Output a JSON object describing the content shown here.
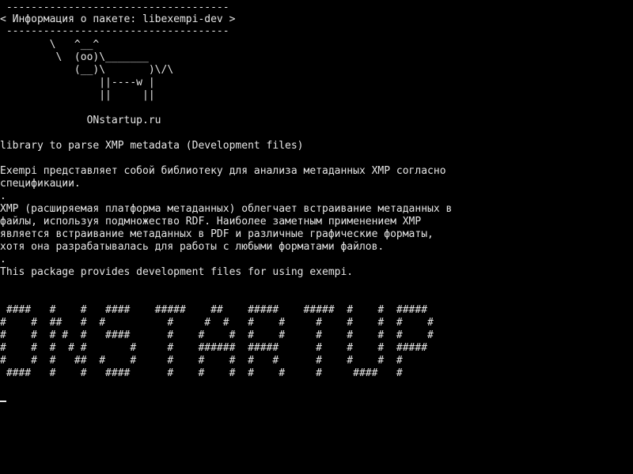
{
  "terminal": {
    "speech_top": " ------------------------------------",
    "speech_text": "< Информация о пакете: libexempi-dev >",
    "speech_bottom": " ------------------------------------",
    "cow": [
      "        \\   ^__^",
      "         \\  (oo)\\_______",
      "            (__)\\       )\\/\\",
      "                ||----w |",
      "                ||     ||"
    ],
    "site": "              ONstartup.ru",
    "summary": "library to parse XMP metadata (Development files)",
    "description": [
      "Exempi представляет собой библиотеку для анализа метаданных XMP согласно",
      "спецификации.",
      ".",
      "XMP (расширяемая платформа метаданных) облегчает встраивание метаданных в",
      "файлы, используя подмножество RDF. Наиболее заметным применением XMP",
      "является встраивание метаданных в PDF и различные графические форматы,",
      "хотя она разрабатывалась для работы с любыми форматами файлов.",
      ".",
      "This package provides development files for using exempi."
    ],
    "banner": [
      " ####   #    #   ####    #####    ##    #####    #####  #    #  #####",
      "#    #  ##   #  #          #     #  #   #    #     #    #    #  #    #",
      "#    #  # #  #   ####      #    #    #  #    #     #    #    #  #    #",
      "#    #  #  # #       #     #    ######  #####      #    #    #  #####",
      "#    #  #   ##  #    #     #    #    #  #   #      #    #    #  #",
      " ####   #    #   ####      #    #    #  #    #     #     ####   #"
    ]
  }
}
